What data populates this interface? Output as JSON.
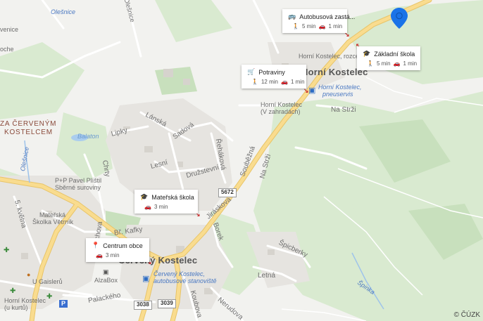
{
  "map": {
    "copyright": "© ČÚZK",
    "towns": {
      "horni_kostelec": "Horní Kostelec",
      "cerveny_kostelec": "Červený Kostelec",
      "za_cervenym_kostelcem_1": "ZA ČERVENÝM",
      "za_cervenym_kostelcem_2": "KOSTELCEM",
      "olesnice": "Olešnice",
      "balaton": "Balaton"
    },
    "streets": [
      "Lánská",
      "Sadová",
      "Lipky",
      "Lesní",
      "Družstevní",
      "Řeháková",
      "Souběžná",
      "Na Strži",
      "Na Strži",
      "Jiráskova",
      "Borek",
      "Čechova",
      "Bř. Kafky",
      "Špicberky",
      "Letná",
      "Koubova",
      "Palackého",
      "Nerudova",
      "5. května",
      "Chrty"
    ],
    "pois": {
      "pp_pavel": "P+P Pavel Plíštil",
      "sberne": "Sběrné suroviny",
      "materska_vetrnik_1": "Mateřská",
      "materska_vetrnik_2": "Školka Větrník",
      "u_gaisleru": "U Gaislerů",
      "alzabox": "AlzaBox",
      "horni_kostelec_v_zahradach_1": "Horní Kostelec",
      "horni_kostelec_v_zahradach_2": "(V zahradách)",
      "horni_kostelec_rozcesti": "Horní Kostelec, rozcestí",
      "pneuservis_1": "Horní Kostelec,",
      "pneuservis_2": "pneuservis",
      "autobusove_1": "Červený Kostelec,",
      "autobusove_2": "autobusové stanoviště",
      "horni_kostelec_u_kurtu_1": "Horní Kostelec",
      "horni_kostelec_u_kurtu_2": "(u kurtů)",
      "olesnice_top": "Olešnice",
      "spinka": "Špinka",
      "venice": "venice",
      "oche": "oche",
      "olesnice_vert": "Olešnice"
    },
    "road_numbers": [
      "5672",
      "3038",
      "3039"
    ]
  },
  "cards": [
    {
      "title": "Autobusová zastá...",
      "icon": "bus-icon",
      "walk": "5 min",
      "drive": "1 min"
    },
    {
      "title": "Základní škola",
      "icon": "school-icon",
      "walk": "5 min",
      "drive": "1 min"
    },
    {
      "title": "Potraviny",
      "icon": "cart-icon",
      "walk": "12 min",
      "drive": "1 min"
    },
    {
      "title": "Mateřská škola",
      "icon": "school-icon",
      "walk": "",
      "drive": "3 min"
    },
    {
      "title": "Centrum obce",
      "icon": "location-pin-icon",
      "walk": "",
      "drive": "3 min"
    }
  ],
  "colors": {
    "pin": "#1a73e8",
    "main_road": "#f7d68a",
    "water_text": "#4a78c2"
  }
}
